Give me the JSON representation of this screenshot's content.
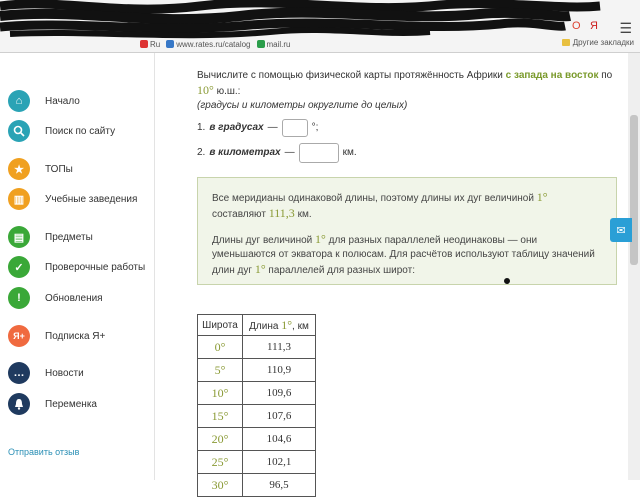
{
  "browser": {
    "bookmarks": [
      "Ru",
      "www.rates.ru/catalog",
      "mail.ru"
    ],
    "bookmarks_right": "Другие закладки"
  },
  "sidebar": {
    "items": [
      {
        "label": "Начало",
        "icon": "home-icon"
      },
      {
        "label": "Поиск по сайту",
        "icon": "search-icon"
      },
      {
        "label": "ТОПы",
        "icon": "star-icon"
      },
      {
        "label": "Учебные заведения",
        "icon": "building-icon"
      },
      {
        "label": "Предметы",
        "icon": "book-icon"
      },
      {
        "label": "Проверочные работы",
        "icon": "check-icon"
      },
      {
        "label": "Обновления",
        "icon": "exclamation-icon"
      },
      {
        "label": "Подписка Я+",
        "icon": "subscription-icon"
      },
      {
        "label": "Новости",
        "icon": "chat-icon"
      },
      {
        "label": "Переменка",
        "icon": "bell-icon"
      }
    ],
    "feedback": "Отправить отзыв"
  },
  "task": {
    "intro_1": "Вычислите с помощью физической карты протяжённость Африки ",
    "highlight": "с запада на восток",
    "intro_2": " по ",
    "latitude": "10°",
    "intro_3": " ю.ш.:",
    "note": "(градусы и километры округлите до целых)",
    "q1_num": "1.",
    "q1_label": "в градусах",
    "q1_dash": "—",
    "q1_unit": "°;",
    "q2_num": "2.",
    "q2_label": "в километрах",
    "q2_dash": "—",
    "q2_unit": "км."
  },
  "hint": {
    "p1_a": "Все меридианы одинаковой длины, поэтому длины их дуг величиной ",
    "p1_deg": "1°",
    "p1_b": " составляют ",
    "p1_val": "111,3",
    "p1_c": " км.",
    "p2_a": "Длины дуг величиной ",
    "p2_deg": "1°",
    "p2_b": " для разных параллелей неодинаковы — они уменьшаются от экватора к полюсам. Для расчётов используют таблицу значений длин дуг ",
    "p2_deg2": "1°",
    "p2_c": " параллелей для разных широт:"
  },
  "table": {
    "col1": "Широта",
    "col2_a": "Длина ",
    "col2_deg": "1°",
    "col2_b": ", км",
    "rows": [
      {
        "lat": "0°",
        "len": "111,3"
      },
      {
        "lat": "5°",
        "len": "110,9"
      },
      {
        "lat": "10°",
        "len": "109,6"
      },
      {
        "lat": "15°",
        "len": "107,6"
      },
      {
        "lat": "20°",
        "len": "104,6"
      },
      {
        "lat": "25°",
        "len": "102,1"
      },
      {
        "lat": "30°",
        "len": "96,5"
      }
    ]
  },
  "colors": {
    "accent": "#7a9a2b",
    "hint_bg": "#f1f5e9",
    "link": "#2a8fb5"
  }
}
